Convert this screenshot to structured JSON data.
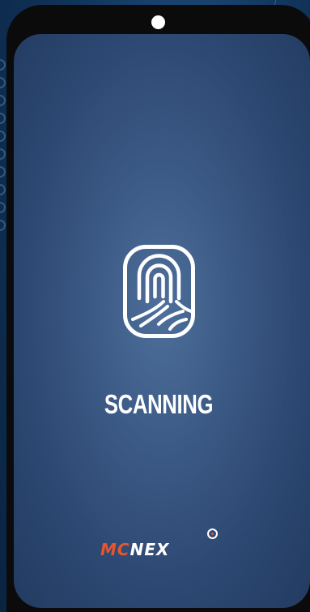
{
  "screen": {
    "status_text": "SCANNING",
    "icon": "fingerprint-icon",
    "background_color": "#3b5985"
  },
  "brand": {
    "logo_part1": "MC",
    "logo_part2": "NEX",
    "logo_mark": "target-ring-icon",
    "accent_color": "#e4572e"
  },
  "device": {
    "camera": "front-camera-icon"
  }
}
